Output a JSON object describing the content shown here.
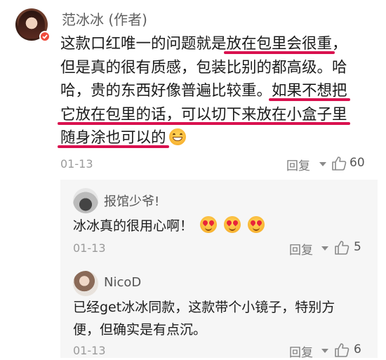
{
  "main_comment": {
    "author": "范冰冰 (作者)",
    "lines": [
      {
        "parts": [
          {
            "text": "这款口红唯一的问题就是"
          },
          {
            "text": "放在包里会很重",
            "hl": true
          },
          {
            "text": "，"
          }
        ]
      },
      {
        "parts": [
          {
            "text": "但是真的很有质感，包装比别的都高级。哈"
          }
        ]
      },
      {
        "parts": [
          {
            "text": "哈，贵的东西好像普遍比较重。"
          },
          {
            "text": "如果不想把",
            "hl": true
          }
        ]
      },
      {
        "parts": [
          {
            "text": "它放在包里的话，可以切下来放在小盒子里",
            "hl": true
          }
        ]
      },
      {
        "parts": [
          {
            "text": "随身涂也可以的",
            "hl": true
          }
        ]
      }
    ],
    "emoji": "grinning-face",
    "date": "01-13",
    "reply_label": "回复",
    "like_count": "60"
  },
  "replies": [
    {
      "author": "报馆少爷!",
      "text_lines": [
        "冰冰真的很用心啊！"
      ],
      "emojis": [
        "heart-eyes",
        "heart-eyes",
        "heart-eyes"
      ],
      "date": "01-13",
      "reply_label": "回复",
      "like_count": "5"
    },
    {
      "author": "NicoD",
      "text_lines": [
        "已经get冰冰同款，这款带个小镜子，特别方",
        "便，但确实是有点沉。"
      ],
      "date": "01-13",
      "reply_label": "回复",
      "like_count": "6"
    }
  ],
  "colors": {
    "highlight_underline": "#d9114f",
    "badge": "#f04b3c",
    "reply_bg": "#f6f6f6"
  }
}
